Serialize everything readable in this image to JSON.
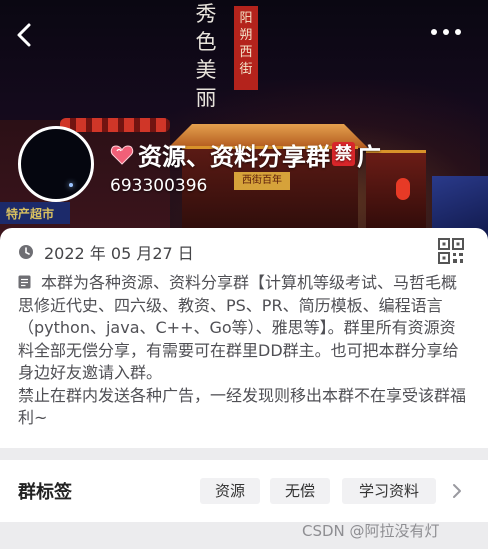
{
  "header": {
    "back_icon": "chevron-left-icon",
    "more_icon": "more-dots-icon",
    "banner_calligraphy": "秀色美丽",
    "banner_seal": "阳朔西街",
    "banner_left_sign": "特产超市",
    "banner_plaque": "西街百年"
  },
  "group": {
    "title_emoji": "heart-icon",
    "title": "资源、资料分享群",
    "title_ban_emoji": "禁",
    "title_suffix": "广",
    "id": "693300396"
  },
  "info": {
    "date_icon": "clock-icon",
    "date": "2022 年 05 月27 日",
    "qr_icon": "qrcode-icon",
    "desc_icon": "document-icon",
    "description_1": "本群为各种资源、资料分享群【计算机等级考试、马哲毛概思修近代史、四六级、教资、PS、PR、简历模板、编程语言（python、java、C++、Go等）、雅思等】。群里所有资源资料全部无偿分享，有需要可在群里DD群主。也可把本群分享给身边好友邀请入群。",
    "description_2": "禁止在群内发送各种广告，一经发现则移出本群不在享受该群福利~"
  },
  "tags": {
    "label": "群标签",
    "items": [
      "资源",
      "无偿",
      "学习资料"
    ],
    "more_icon": "chevron-right-icon"
  },
  "watermark": "CSDN @阿拉没有灯",
  "colors": {
    "card_bg": "#ffffff",
    "page_bg": "#ececee",
    "tag_bg": "#f1f1f3",
    "seal_red": "#b4231c"
  }
}
